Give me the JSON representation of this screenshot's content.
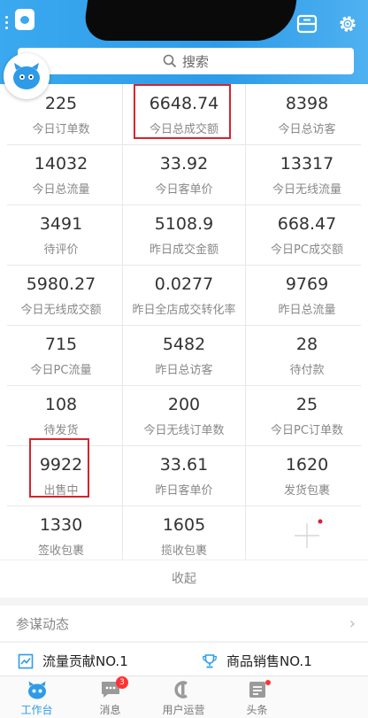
{
  "search": {
    "placeholder": "搜索"
  },
  "metrics": [
    {
      "value": "225",
      "label": "今日订单数"
    },
    {
      "value": "6648.74",
      "label": "今日总成交额"
    },
    {
      "value": "8398",
      "label": "今日总访客"
    },
    {
      "value": "14032",
      "label": "今日总流量"
    },
    {
      "value": "33.92",
      "label": "今日客单价"
    },
    {
      "value": "13317",
      "label": "今日无线流量"
    },
    {
      "value": "3491",
      "label": "待评价"
    },
    {
      "value": "5108.9",
      "label": "昨日成交金额"
    },
    {
      "value": "668.47",
      "label": "今日PC成交额"
    },
    {
      "value": "5980.27",
      "label": "今日无线成交额"
    },
    {
      "value": "0.0277",
      "label": "昨日全店成交转化率"
    },
    {
      "value": "9769",
      "label": "昨日总流量"
    },
    {
      "value": "715",
      "label": "今日PC流量"
    },
    {
      "value": "5482",
      "label": "昨日总访客"
    },
    {
      "value": "28",
      "label": "待付款"
    },
    {
      "value": "108",
      "label": "待发货"
    },
    {
      "value": "200",
      "label": "今日无线订单数"
    },
    {
      "value": "25",
      "label": "今日PC订单数"
    },
    {
      "value": "9922",
      "label": "出售中"
    },
    {
      "value": "33.61",
      "label": "昨日客单价"
    },
    {
      "value": "1620",
      "label": "发货包裹"
    },
    {
      "value": "1330",
      "label": "签收包裹"
    },
    {
      "value": "1605",
      "label": "揽收包裹"
    }
  ],
  "collapse_label": "收起",
  "insights": {
    "title": "参谋动态",
    "items": [
      {
        "label": "流量贡献NO.1",
        "icon": "trend-chart-icon"
      },
      {
        "label": "商品销售NO.1",
        "icon": "trophy-icon"
      }
    ]
  },
  "tabs": [
    {
      "label": "工作台",
      "icon": "workbench-mascot-icon",
      "active": true
    },
    {
      "label": "消息",
      "icon": "message-icon",
      "badge": "3"
    },
    {
      "label": "用户运营",
      "icon": "user-ops-icon"
    },
    {
      "label": "头条",
      "icon": "headline-icon",
      "dot": true
    }
  ],
  "colors": {
    "primary": "#2d9be8",
    "highlight": "#d8232a",
    "badge": "#ff3333"
  }
}
